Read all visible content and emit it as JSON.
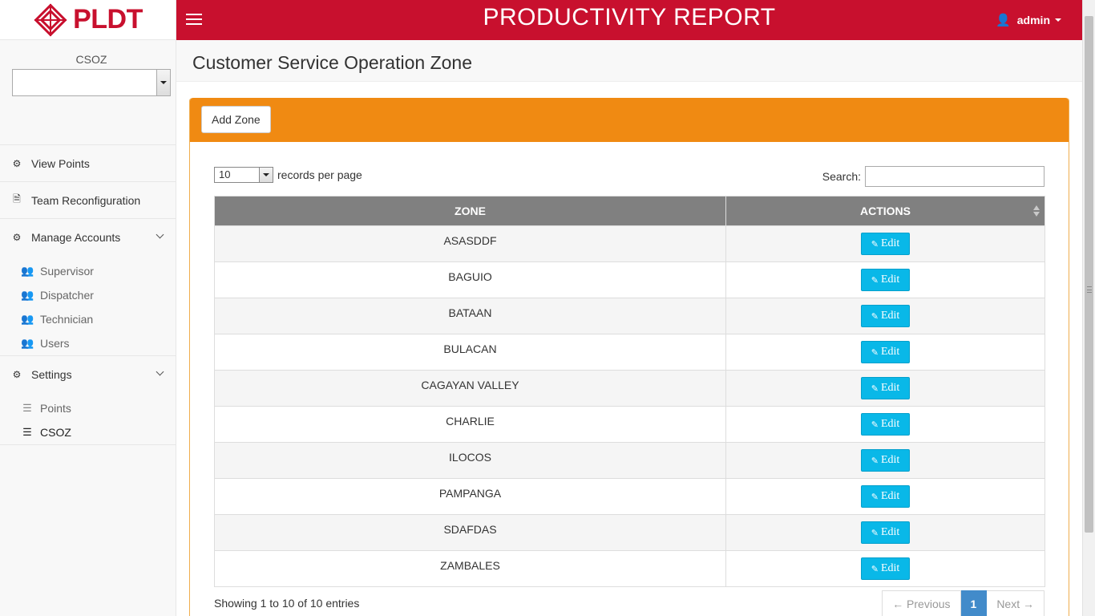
{
  "brand": {
    "name": "PLDT",
    "color": "#c8102e"
  },
  "topbar": {
    "title": "PRODUCTIVITY REPORT",
    "user": "admin"
  },
  "sidebar": {
    "csoz_label": "CSOZ",
    "csoz_value": "",
    "items": [
      {
        "label": "View Points",
        "icon": "gear-icon"
      },
      {
        "label": "Team Reconfiguration",
        "icon": "file-icon"
      },
      {
        "label": "Manage Accounts",
        "icon": "gear-icon"
      },
      {
        "label": "Settings",
        "icon": "gear-icon"
      }
    ],
    "accounts_sub": [
      "Supervisor",
      "Dispatcher",
      "Technician",
      "Users"
    ],
    "settings_sub": [
      "Points",
      "CSOZ"
    ]
  },
  "page": {
    "title": "Customer Service Operation Zone"
  },
  "panel": {
    "add_button": "Add Zone",
    "header_color": "#f08a12"
  },
  "table_controls": {
    "length_value": "10",
    "length_suffix": "records per page",
    "search_label": "Search:",
    "search_value": ""
  },
  "table": {
    "columns": [
      "ZONE",
      "ACTIONS"
    ],
    "edit_label": "Edit",
    "rows": [
      "ASASDDF",
      "BAGUIO",
      "BATAAN",
      "BULACAN",
      "CAGAYAN VALLEY",
      "CHARLIE",
      "ILOCOS",
      "PAMPANGA",
      "SDAFDAS",
      "ZAMBALES"
    ]
  },
  "footer": {
    "info": "Showing 1 to 10 of 10 entries",
    "prev": "← Previous",
    "page": "1",
    "next": "Next →"
  }
}
